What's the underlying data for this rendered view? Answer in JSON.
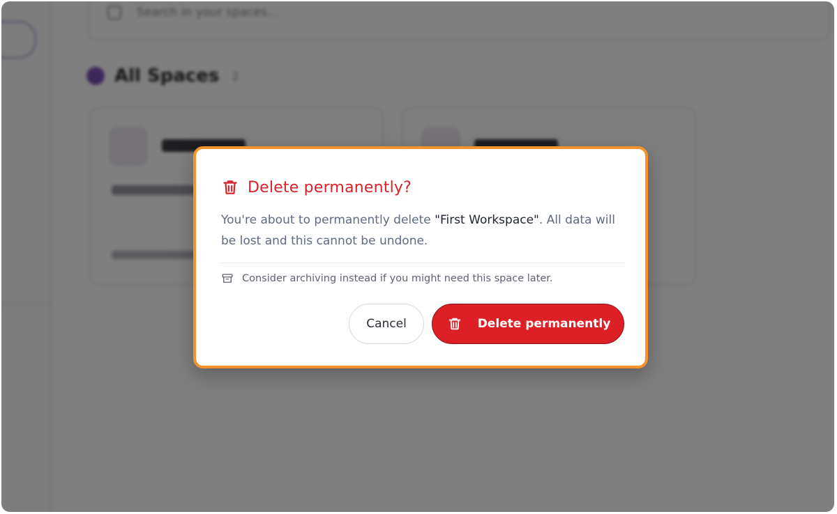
{
  "background": {
    "search_placeholder": "Search in your spaces...",
    "section_title": "All Spaces",
    "section_count": "2"
  },
  "dialog": {
    "title": "Delete permanently?",
    "message_prefix": "You're about to permanently delete ",
    "message_name": "\"First Workspace\"",
    "message_suffix": ". All data will be lost and this cannot be undone.",
    "hint": "Consider archiving instead if you might need this space later.",
    "cancel_label": "Cancel",
    "delete_label": "Delete permanently"
  },
  "icons": {
    "title_icon": "trash-icon",
    "hint_icon": "archive-icon",
    "delete_button_icon": "trash-icon"
  },
  "colors": {
    "danger": "#dc2026",
    "danger_text": "#d8222a",
    "focus_outline": "#f4922c",
    "overlay": "rgba(0,0,0,0.5)"
  }
}
